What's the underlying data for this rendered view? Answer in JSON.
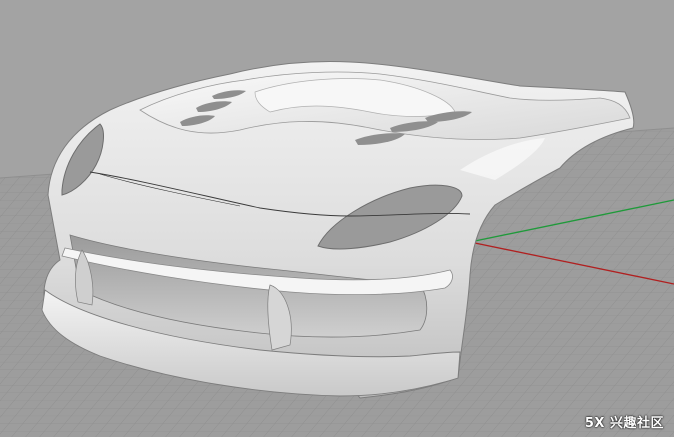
{
  "viewport": {
    "background_color": "#a3a3a3",
    "grid_color": "#8a8a8a",
    "ground_color": "#9c9c9c",
    "x_axis_color": "#b02020",
    "y_axis_color": "#1f9a3a",
    "model_color": "#ececec"
  },
  "watermark": {
    "text": "5X 兴趣社区"
  }
}
